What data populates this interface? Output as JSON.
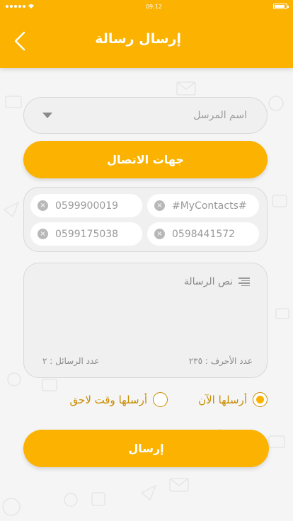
{
  "status_bar": {
    "time": "09:12"
  },
  "header": {
    "title": "إرسال رسالة",
    "back_icon": "chevron-left-icon"
  },
  "sender": {
    "label": "اسم المرسل",
    "icon": "caret-down-icon"
  },
  "contacts_button": {
    "label": "جهات الاتصال"
  },
  "recipients": [
    {
      "text": "#MyContacts#"
    },
    {
      "text": "0599900019"
    },
    {
      "text": "0598441572"
    },
    {
      "text": "0599175038"
    }
  ],
  "message": {
    "label": "نص الرسالة",
    "char_count": "عدد الأحرف : ٢٣٥",
    "message_count": "عدد الرسائل : ٢"
  },
  "send_options": {
    "now": {
      "label": "أرسلها الآن",
      "selected": true
    },
    "later": {
      "label": "أرسلها وقت لاحق",
      "selected": false
    }
  },
  "send_button": {
    "label": "إرسال"
  },
  "colors": {
    "accent": "#fbb200",
    "radio_text": "#c98d00",
    "background": "#f5f5f5"
  }
}
